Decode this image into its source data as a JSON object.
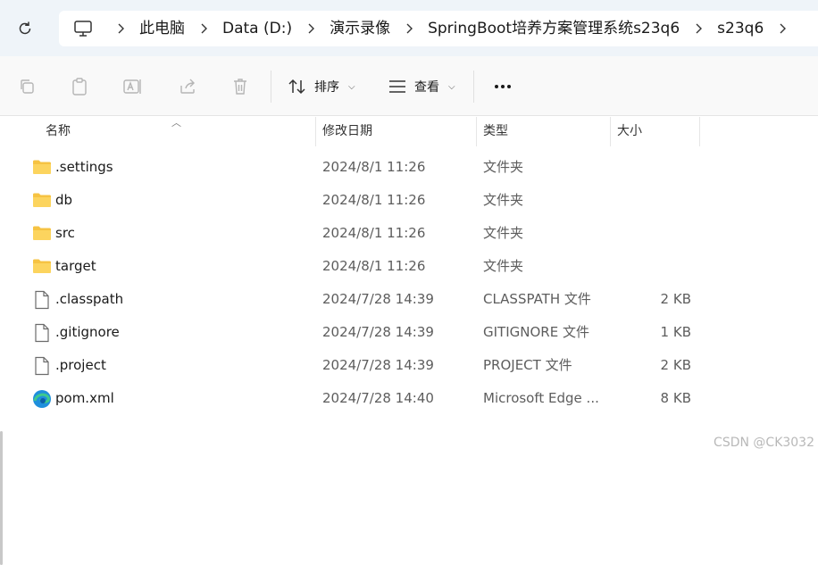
{
  "breadcrumb": [
    "此电脑",
    "Data (D:)",
    "演示录像",
    "SpringBoot培养方案管理系统s23q6",
    "s23q6"
  ],
  "toolbar": {
    "sort_label": "排序",
    "view_label": "查看"
  },
  "columns": {
    "name": "名称",
    "date": "修改日期",
    "type": "类型",
    "size": "大小"
  },
  "files": [
    {
      "name": ".settings",
      "date": "2024/8/1 11:26",
      "type": "文件夹",
      "size": "",
      "icon": "folder-icon"
    },
    {
      "name": "db",
      "date": "2024/8/1 11:26",
      "type": "文件夹",
      "size": "",
      "icon": "folder-icon"
    },
    {
      "name": "src",
      "date": "2024/8/1 11:26",
      "type": "文件夹",
      "size": "",
      "icon": "folder-icon"
    },
    {
      "name": "target",
      "date": "2024/8/1 11:26",
      "type": "文件夹",
      "size": "",
      "icon": "folder-icon"
    },
    {
      "name": ".classpath",
      "date": "2024/7/28 14:39",
      "type": "CLASSPATH 文件",
      "size": "2 KB",
      "icon": "file-icon"
    },
    {
      "name": ".gitignore",
      "date": "2024/7/28 14:39",
      "type": "GITIGNORE 文件",
      "size": "1 KB",
      "icon": "file-icon"
    },
    {
      "name": ".project",
      "date": "2024/7/28 14:39",
      "type": "PROJECT 文件",
      "size": "2 KB",
      "icon": "file-icon"
    },
    {
      "name": "pom.xml",
      "date": "2024/7/28 14:40",
      "type": "Microsoft Edge ...",
      "size": "8 KB",
      "icon": "edge-icon"
    }
  ],
  "watermark": "CSDN @CK3032",
  "colors": {
    "folder": "#f6c343",
    "address_bg": "#eff4f9",
    "command_bg": "#f9f9f9"
  }
}
